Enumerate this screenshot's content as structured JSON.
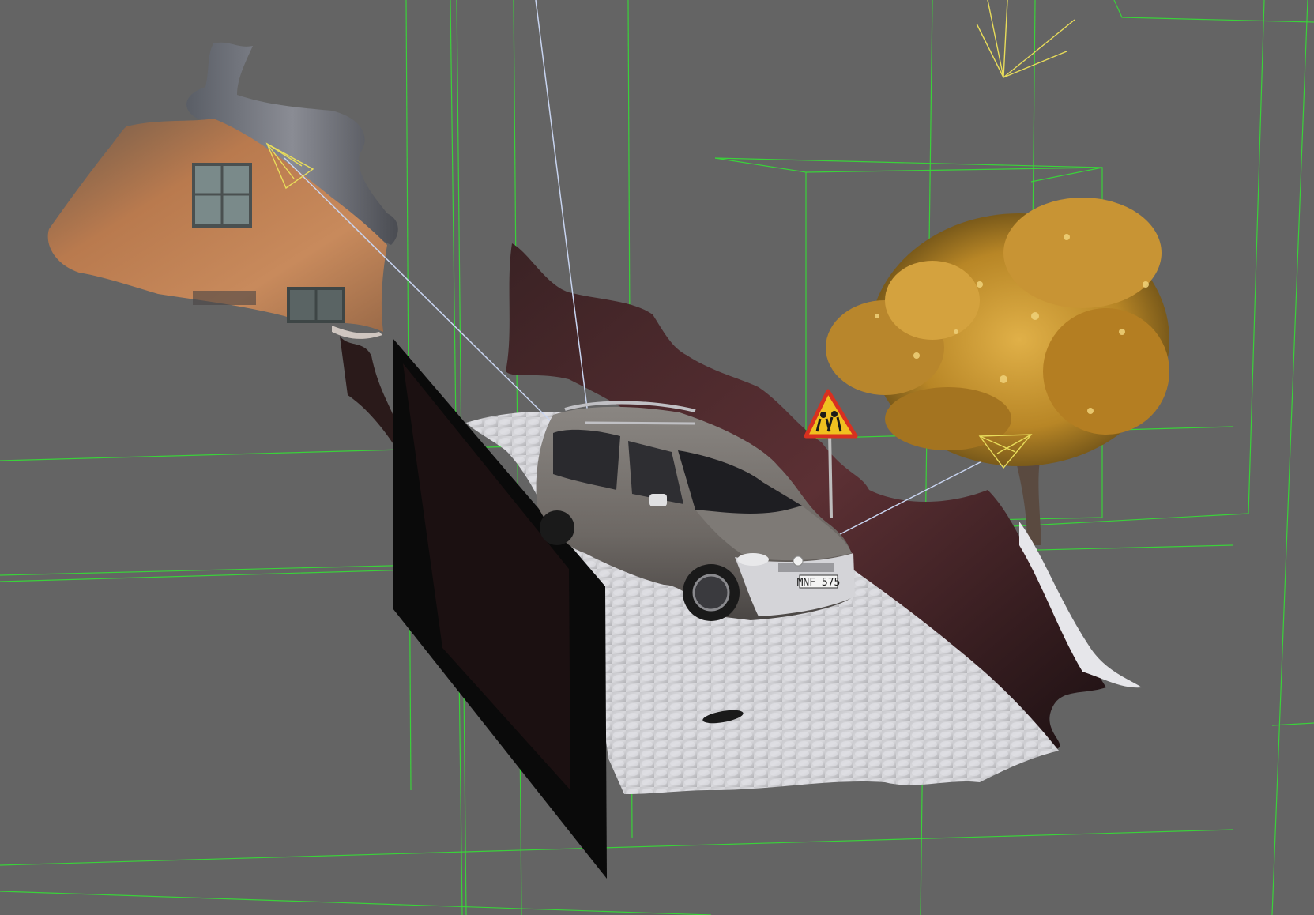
{
  "viewport": {
    "background_color": "#646464",
    "bounding_box_color": "#3ad23a",
    "camera_gizmo_color": "#e8dc5a",
    "light_line_color": "#c8d4f0"
  },
  "scene": {
    "objects": [
      {
        "name": "house",
        "kind": "textured-mesh"
      },
      {
        "name": "wall-plane",
        "kind": "plane"
      },
      {
        "name": "cobblestone-road",
        "kind": "textured-mesh"
      },
      {
        "name": "van",
        "kind": "model",
        "color": "#6d6864"
      },
      {
        "name": "warning-sign",
        "kind": "model"
      },
      {
        "name": "tree",
        "kind": "model",
        "foliage_color": "#c8962e"
      },
      {
        "name": "rock-terrain",
        "kind": "textured-mesh"
      }
    ],
    "van": {
      "license_plate": "MNF 575"
    }
  }
}
